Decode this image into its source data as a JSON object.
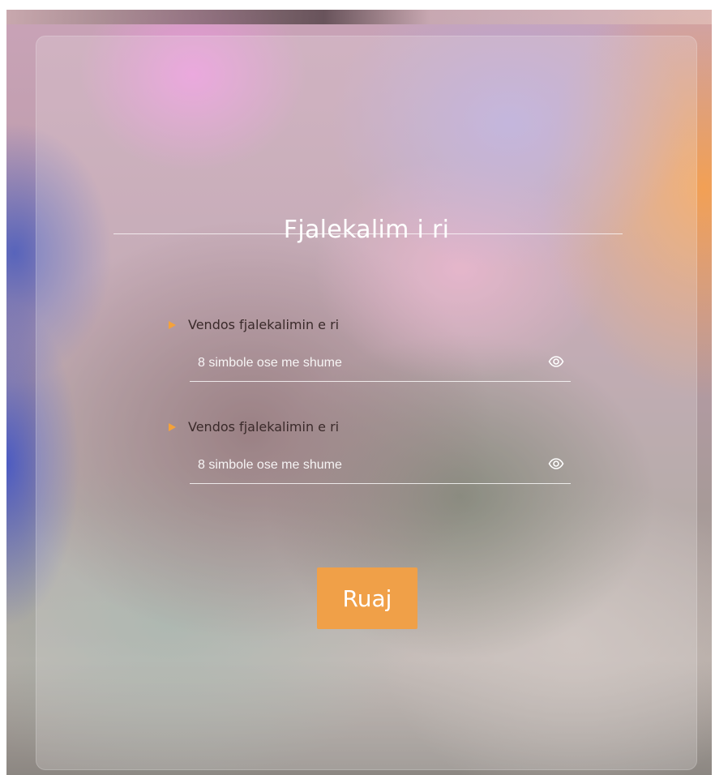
{
  "form": {
    "title": "Fjalekalim i ri",
    "fields": [
      {
        "label": "Vendos fjalekalimin e ri",
        "placeholder": "8 simbole ose me shume",
        "value": "",
        "toggle_icon": "eye-icon"
      },
      {
        "label": "Vendos fjalekalimin e ri",
        "placeholder": "8 simbole ose me shume",
        "value": "",
        "toggle_icon": "eye-icon"
      }
    ],
    "submit_label": "Ruaj"
  },
  "colors": {
    "accent": "#f0a048",
    "arrow": "#f4a23a",
    "label_text": "#3a2a2a",
    "light_text": "#ffffff"
  }
}
